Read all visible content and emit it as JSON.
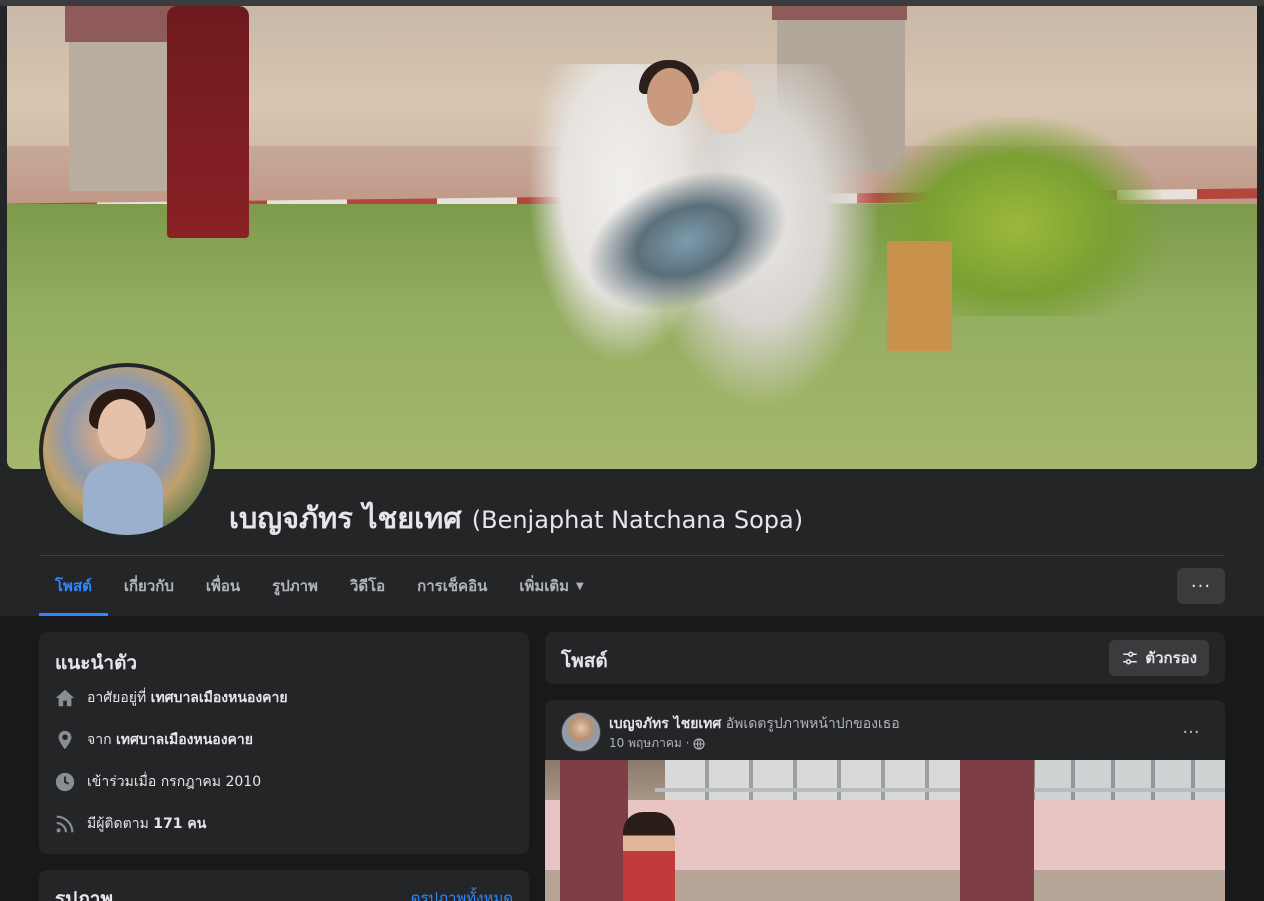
{
  "profile": {
    "name": "เบญจภัทร ไชยเทศ",
    "alt_name": "(Benjaphat Natchana Sopa)"
  },
  "tabs": [
    {
      "label": "โพสต์",
      "active": true
    },
    {
      "label": "เกี่ยวกับ",
      "active": false
    },
    {
      "label": "เพื่อน",
      "active": false
    },
    {
      "label": "รูปภาพ",
      "active": false
    },
    {
      "label": "วิดีโอ",
      "active": false
    },
    {
      "label": "การเช็คอิน",
      "active": false
    },
    {
      "label": "เพิ่มเติม",
      "active": false
    }
  ],
  "more_button": "···",
  "intro": {
    "title": "แนะนำตัว",
    "lives_prefix": "อาศัยอยู่ที่",
    "lives_place": "เทศบาลเมืองหนองคาย",
    "from_prefix": "จาก",
    "from_place": "เทศบาลเมืองหนองคาย",
    "joined": "เข้าร่วมเมื่อ กรกฎาคม 2010",
    "followers_prefix": "มีผู้ติดตาม",
    "followers_count": "171 คน"
  },
  "photos_section": {
    "title": "รูปภาพ",
    "see_all": "ดูรูปภาพทั้งหมด"
  },
  "posts_header": {
    "title": "โพสต์",
    "filter_label": "ตัวกรอง"
  },
  "post": {
    "author": "เบญจภัทร ไชยเทศ",
    "action": "อัพเดตรูปภาพหน้าปกของเธอ",
    "date": "10 พฤษภาคม ·",
    "more": "···"
  },
  "icons": {
    "home": "home-icon",
    "location": "location-pin-icon",
    "clock": "clock-icon",
    "rss": "rss-icon",
    "filter": "filter-sliders-icon",
    "globe": "globe-icon",
    "caret": "caret-down-icon"
  },
  "colors": {
    "accent": "#2d88ff",
    "card": "#242526",
    "background": "#18191a",
    "text": "#e4e6eb",
    "muted": "#b0b3b8"
  }
}
